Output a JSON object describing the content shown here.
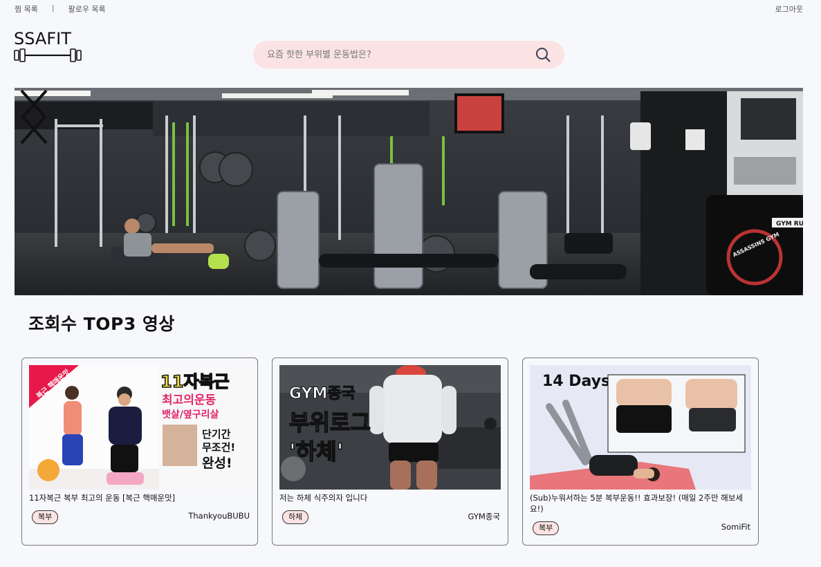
{
  "topbar": {
    "wishlist": "찜 목록",
    "separator": "|",
    "follow_list": "팔로우 목록",
    "logout": "로그아웃"
  },
  "logo": {
    "text": "SSAFIT"
  },
  "search": {
    "placeholder": "요즘 핫한 부위별 운동법은?"
  },
  "banner": {
    "sign_text": "ASSASSINS GYM",
    "desk_text": "GYM RU"
  },
  "section": {
    "title": "조회수 TOP3 영상"
  },
  "videos": [
    {
      "title": "11자복근 복부 최고의 운동 [복근 핵매운맛]",
      "tag": "복부",
      "channel": "ThankyouBUBU",
      "thumb": {
        "badge": "복근 핵매운맛",
        "line1": "11자복근",
        "line2": "최고의운동",
        "line3": "뱃살/옆구리살",
        "line4": "단기간",
        "line5": "무조건!",
        "line6": "완성!"
      }
    },
    {
      "title": "저는 하체 식주의자 입니다",
      "tag": "하체",
      "channel": "GYM종국",
      "thumb": {
        "line1": "GYM종국",
        "line2": "부위로그",
        "line3": "'하체'"
      }
    },
    {
      "title": "(Sub)누워서하는 5분 복부운동!! 효과보장! (매일 2주만 해보세요!)",
      "tag": "복부",
      "channel": "SomiFit",
      "thumb": {
        "line1": "14 Days"
      }
    }
  ]
}
